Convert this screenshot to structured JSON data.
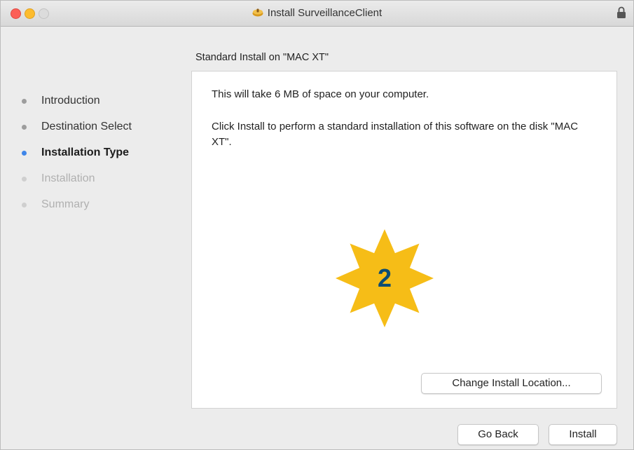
{
  "window": {
    "title": "Install SurveillanceClient",
    "controls": [
      "close",
      "minimize",
      "zoom"
    ]
  },
  "sidebar": {
    "steps": [
      {
        "label": "Introduction",
        "state": "done"
      },
      {
        "label": "Destination Select",
        "state": "done"
      },
      {
        "label": "Installation Type",
        "state": "active"
      },
      {
        "label": "Installation",
        "state": "pending"
      },
      {
        "label": "Summary",
        "state": "pending"
      }
    ]
  },
  "main": {
    "heading": "Standard Install on \"MAC XT\"",
    "space_text": "This will take 6 MB of space on your computer.",
    "description": "Click Install to perform a standard installation of this software on the disk \"MAC XT\".",
    "step_badge": "2",
    "change_location_label": "Change Install Location..."
  },
  "footer": {
    "go_back_label": "Go Back",
    "install_label": "Install"
  },
  "colors": {
    "accent": "#3f86e9",
    "badge": "#f6bd17",
    "badge_text": "#0e4d73",
    "close": "#fc5f57",
    "minimize": "#fdbc2e"
  },
  "icons": {
    "title_icon": "package-icon",
    "titlebar_right": "lock-icon"
  }
}
